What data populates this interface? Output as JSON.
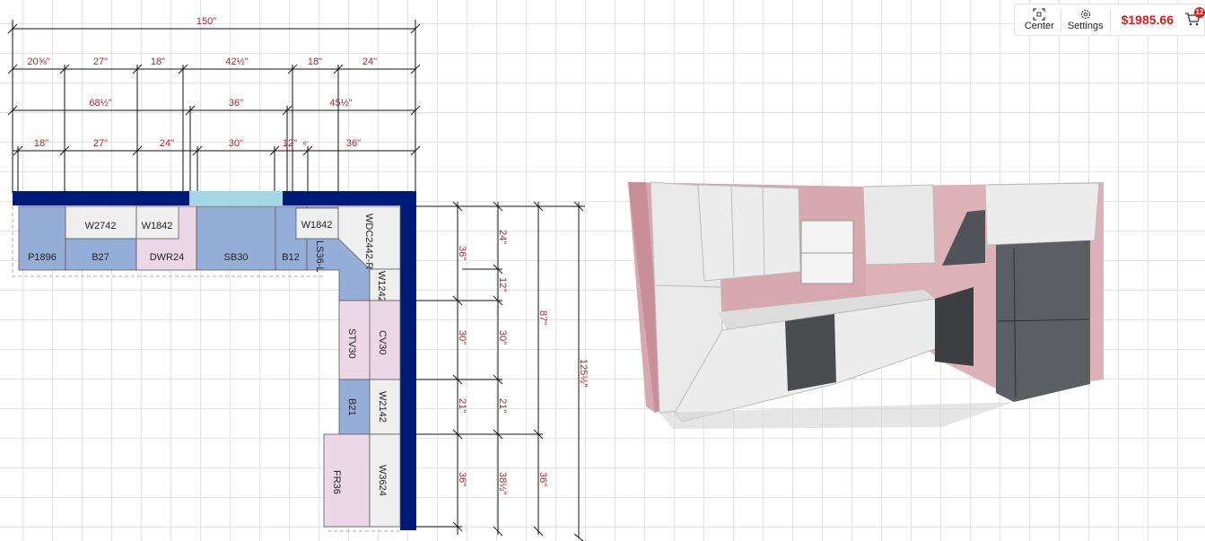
{
  "toolbar": {
    "center_label": "Center",
    "settings_label": "Settings",
    "price": "$1985.66",
    "cart_count": "12"
  },
  "plan": {
    "overall_width": "150\"",
    "upper_row1": [
      "20⅝\"",
      "27\"",
      "18\"",
      "42½\"",
      "18\"",
      "24\""
    ],
    "upper_row2": [
      "68½\"",
      "36\"",
      "45½\""
    ],
    "base_row": [
      "18\"",
      "27\"",
      "24\"",
      "30\"",
      "12\"",
      "36\""
    ],
    "cabinets": {
      "p1896": "P1896",
      "w2742": "W2742",
      "b27": "B27",
      "w1842a": "W1842",
      "dwr24": "DWR24",
      "sb30": "SB30",
      "w1842b": "W1842",
      "b12": "B12",
      "ls36l": "LS36-L",
      "wdc2442r": "WDC2442-R",
      "w1242": "W1242",
      "stv30": "STV30",
      "cv30": "CV30",
      "b21": "B21",
      "w2142": "W2142",
      "fr36": "FR36",
      "w3624": "W3624"
    },
    "right_col1": [
      "36\"",
      "30\"",
      "21\"",
      "36\""
    ],
    "right_col2": [
      "24\"",
      "12\"",
      "30\"",
      "21\"",
      "38½\""
    ],
    "right_col3": [
      "87\"",
      "36\""
    ],
    "overall_depth": "125½\""
  }
}
